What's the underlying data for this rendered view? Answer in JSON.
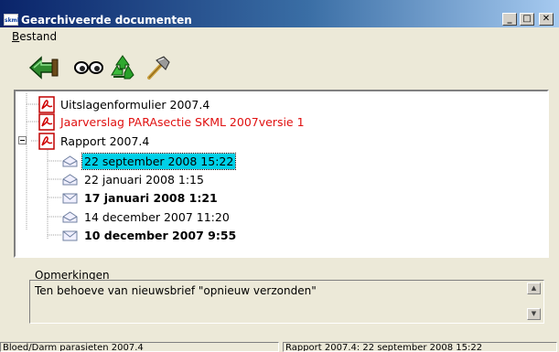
{
  "window": {
    "title": "Gearchiveerde documenten",
    "logo_text": "skml",
    "minimize_glyph": "_",
    "maximize_glyph": "□",
    "close_glyph": "✕"
  },
  "menu": {
    "items": [
      "Bestand"
    ]
  },
  "toolbar": {
    "buttons": [
      {
        "icon": "back-arrow-icon"
      },
      {
        "icon": "view-glasses-icon"
      },
      {
        "icon": "recycle-icon"
      },
      {
        "icon": "hammer-icon"
      }
    ]
  },
  "tree": {
    "nodes": [
      {
        "label": "Uitslagenformulier 2007.4",
        "icon": "pdf-icon"
      },
      {
        "label": "Jaarverslag PARAsectie SKML 2007versie 1",
        "icon": "pdf-icon",
        "color": "#e01010"
      },
      {
        "label": "Rapport 2007.4",
        "icon": "pdf-icon",
        "expanded": true,
        "children": [
          {
            "label": "22 september 2008  15:22",
            "icon": "mail-open-icon",
            "selected": true
          },
          {
            "label": "22 januari 2008  1:15",
            "icon": "mail-open-icon"
          },
          {
            "label": "17 januari 2008  1:21",
            "icon": "mail-closed-icon",
            "bold": true
          },
          {
            "label": "14 december 2007  11:20",
            "icon": "mail-open-icon"
          },
          {
            "label": "10 december 2007  9:55",
            "icon": "mail-closed-icon",
            "bold": true
          }
        ]
      }
    ]
  },
  "remarks": {
    "label": "Opmerkingen",
    "text": "Ten behoeve van nieuwsbrief \"opnieuw verzonden\""
  },
  "status": {
    "left": "Bloed/Darm parasieten 2007.4",
    "right": "Rapport 2007.4: 22 september 2008  15:22"
  }
}
